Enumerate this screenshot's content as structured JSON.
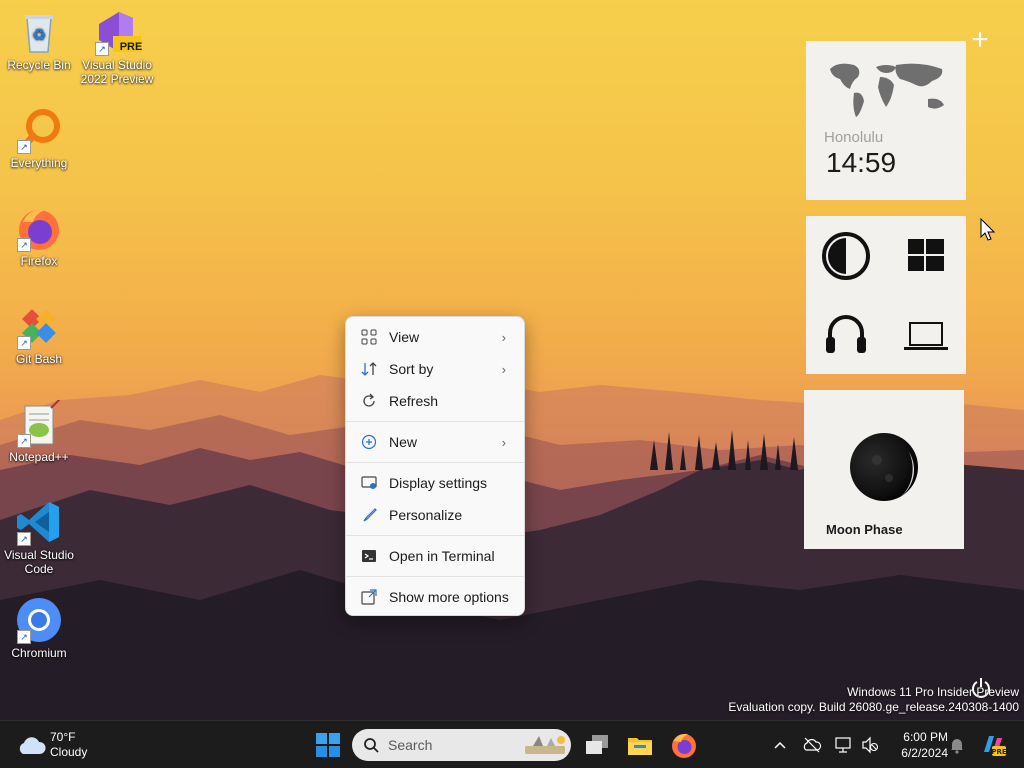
{
  "desktop_icons": [
    {
      "label": "Recycle Bin"
    },
    {
      "label": "Visual Studio 2022 Preview",
      "badge": "PRE"
    },
    {
      "label": "Everything"
    },
    {
      "label": "Firefox"
    },
    {
      "label": "Git Bash"
    },
    {
      "label": "Notepad++"
    },
    {
      "label": "Visual Studio Code"
    },
    {
      "label": "Chromium"
    }
  ],
  "context_menu": {
    "items": [
      {
        "label": "View",
        "icon": "grid-icon"
      },
      {
        "label": "Sort by",
        "icon": "sort-icon"
      },
      {
        "label": "Refresh",
        "icon": "refresh-icon"
      },
      {
        "label": "New",
        "icon": "plus-circle-icon"
      },
      {
        "label": "Display settings",
        "icon": "display-icon"
      },
      {
        "label": "Personalize",
        "icon": "brush-icon"
      },
      {
        "label": "Open in Terminal",
        "icon": "terminal-icon"
      },
      {
        "label": "Show more options",
        "icon": "external-icon"
      }
    ]
  },
  "widgets": {
    "add_icon": "+",
    "clock": {
      "city": "Honolulu",
      "time": "14:59"
    },
    "shortcuts": [
      "contrast-icon",
      "windows-icon",
      "headphones-icon",
      "laptop-icon"
    ],
    "moon": {
      "label": "Moon Phase"
    }
  },
  "watermark": {
    "line1": "Windows 11 Pro Insider Preview",
    "line2": "Evaluation copy. Build 26080.ge_release.240308-1400"
  },
  "taskbar": {
    "weather": {
      "temp": "70°F",
      "condition": "Cloudy"
    },
    "search_placeholder": "Search",
    "time": "6:00 PM",
    "date": "6/2/2024"
  }
}
